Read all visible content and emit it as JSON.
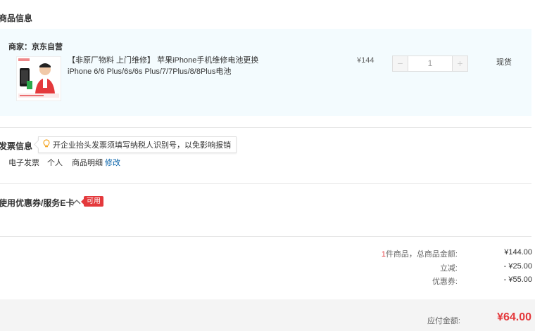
{
  "goods": {
    "section_title": "商品信息",
    "merchant_label": "商家：京东自营",
    "product_name": "【非原厂物料 上门维修】 苹果iPhone手机维修电池更换 iPhone 6/6 Plus/6s/6s Plus/7/7Plus/8/8Plus电池",
    "price": "¥144",
    "quantity": "1",
    "minus_label": "−",
    "plus_label": "+",
    "stock_status": "现货",
    "thumb_icon": "product-thumbnail-image"
  },
  "invoice": {
    "section_title": "发票信息",
    "tip": "开企业抬头发票须填写纳税人识别号，以免影响报销",
    "tip_icon": "lightbulb-icon",
    "type": "电子发票",
    "title": "个人",
    "content": "商品明细",
    "edit_label": "修改"
  },
  "coupons": {
    "section_title": "使用优惠券/服务E卡",
    "toggle_icon": "chevron-up-icon",
    "badge": "可用"
  },
  "summary": {
    "item_count": "1",
    "total_label": "件商品，总商品金额:",
    "total_value": "¥144.00",
    "discount_label": "立减:",
    "discount_value": "- ¥25.00",
    "coupon_label": "优惠券:",
    "coupon_value": "- ¥55.00",
    "payable_label": "应付金额:",
    "payable_value": "¥64.00"
  },
  "colors": {
    "accent_red": "#e4393c",
    "link_blue": "#005ea7",
    "panel_bg": "#f3fbfe"
  }
}
